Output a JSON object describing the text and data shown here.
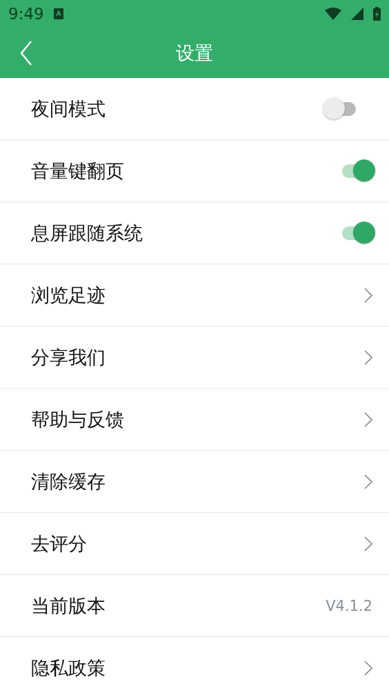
{
  "status_bar": {
    "time": "9:49"
  },
  "header": {
    "title": "设置"
  },
  "items": [
    {
      "kind": "toggle",
      "label": "夜间模式",
      "on": false
    },
    {
      "kind": "toggle",
      "label": "音量键翻页",
      "on": true
    },
    {
      "kind": "toggle",
      "label": "息屏跟随系统",
      "on": true
    },
    {
      "kind": "link",
      "label": "浏览足迹"
    },
    {
      "kind": "link",
      "label": "分享我们"
    },
    {
      "kind": "link",
      "label": "帮助与反馈"
    },
    {
      "kind": "link",
      "label": "清除缓存"
    },
    {
      "kind": "link",
      "label": "去评分"
    },
    {
      "kind": "value",
      "label": "当前版本",
      "value": "V4.1.2"
    },
    {
      "kind": "link",
      "label": "隐私政策"
    }
  ]
}
